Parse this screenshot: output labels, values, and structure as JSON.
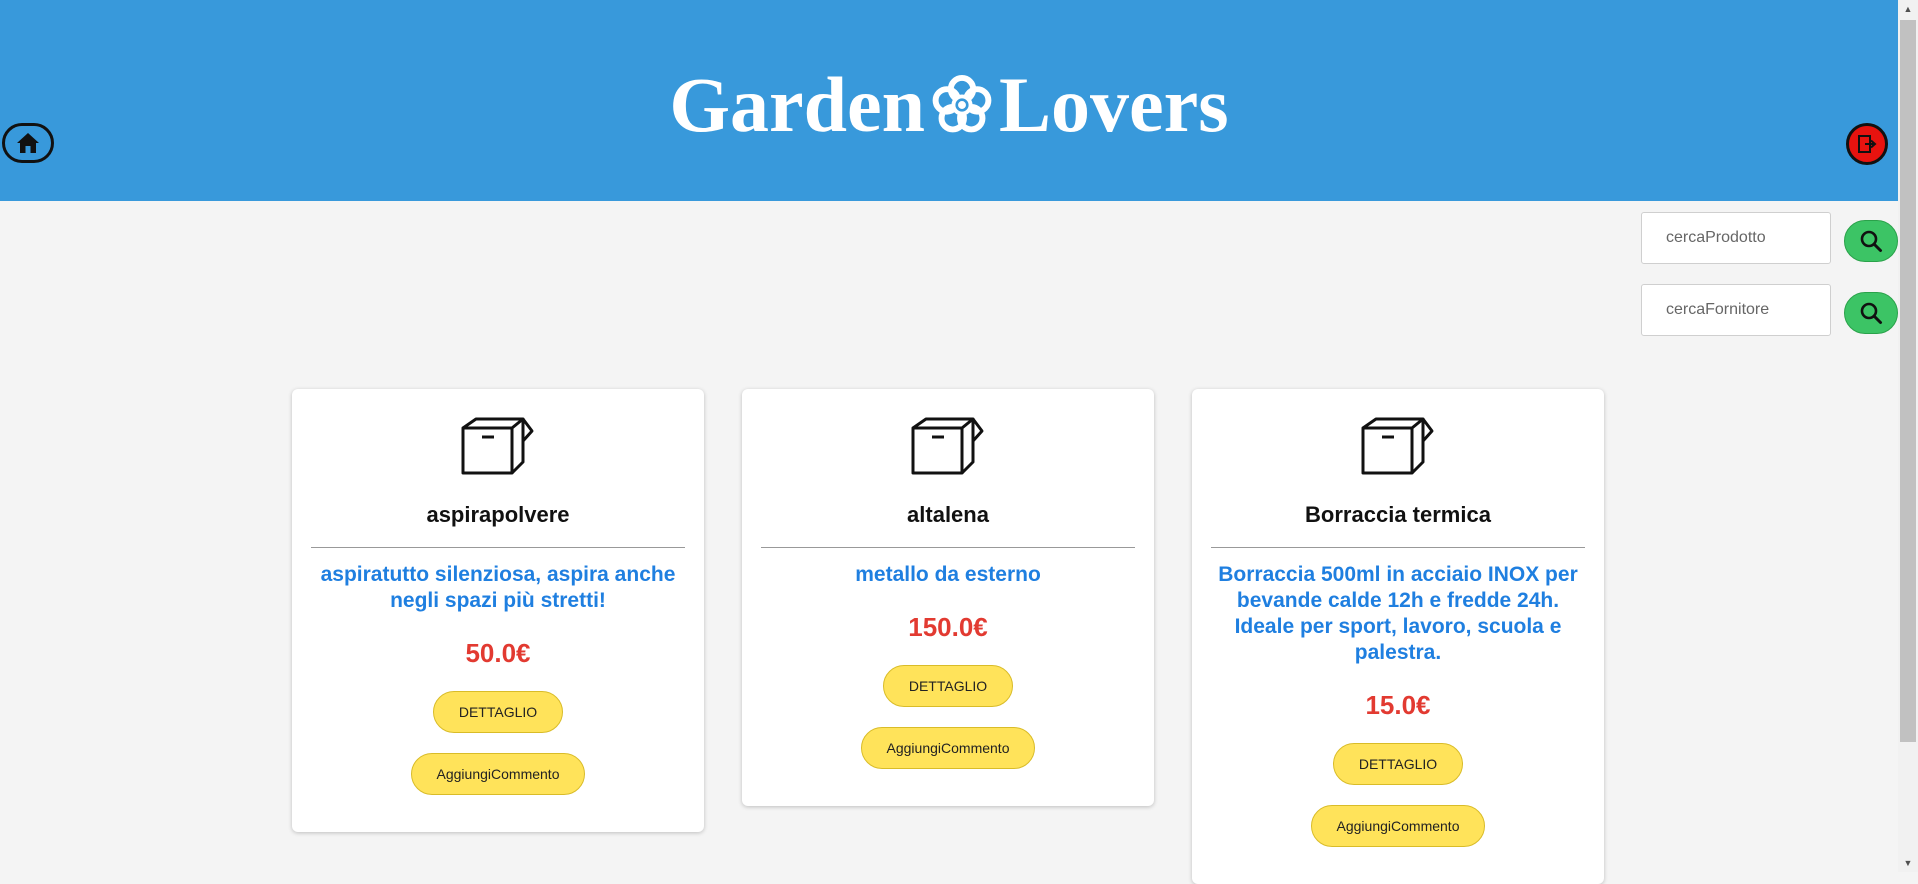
{
  "header": {
    "brand_left": "Garden",
    "brand_right": "Lovers",
    "home_icon": "home-icon",
    "logout_icon": "logout-icon",
    "bg_color": "#3899db"
  },
  "search": {
    "product_placeholder": "cercaProdotto",
    "supplier_placeholder": "cercaFornitore",
    "button_icon": "search-icon"
  },
  "products": [
    {
      "name": "aspirapolvere",
      "description": "aspiratutto silenziosa, aspira anche negli spazi più stretti!",
      "price": "50.0€",
      "detail_label": "DETTAGLIO",
      "comment_label": "AggiungiCommento"
    },
    {
      "name": "altalena",
      "description": "metallo da esterno",
      "price": "150.0€",
      "detail_label": "DETTAGLIO",
      "comment_label": "AggiungiCommento"
    },
    {
      "name": "Borraccia termica",
      "description": "Borraccia 500ml in acciaio INOX per bevande calde 12h e fredde 24h. Ideale per sport, lavoro, scuola e palestra.",
      "price": "15.0€",
      "detail_label": "DETTAGLIO",
      "comment_label": "AggiungiCommento"
    }
  ],
  "colors": {
    "description": "#1f7fe0",
    "price": "#e23a31",
    "button": "#ffe35a",
    "search_button": "#3cc465",
    "logout": "#e8130f"
  }
}
